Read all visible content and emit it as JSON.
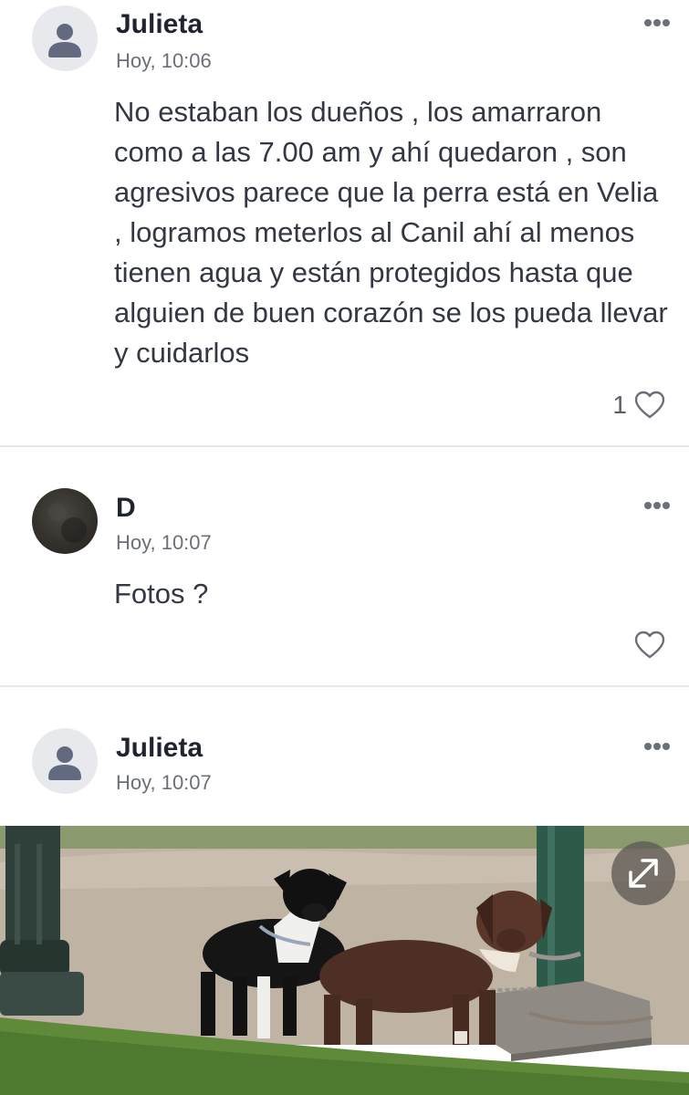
{
  "comments": [
    {
      "author": "Julieta",
      "time": "Hoy, 10:06",
      "text": "No estaban los dueños , los amarraron como a las 7.00 am y ahí quedaron , son agresivos parece que la perra está en Velia , logramos meterlos al Canil ahí al menos tienen agua y están protegidos hasta que alguien de buen corazón se los pueda llevar y cuidarlos",
      "likes": "1",
      "avatar_icon": "person-icon"
    },
    {
      "author": "D",
      "time": "Hoy, 10:07",
      "text": "Fotos ?",
      "likes": "",
      "avatar_icon": "dark-photo-avatar"
    },
    {
      "author": "Julieta",
      "time": "Hoy, 10:07",
      "text": "",
      "likes": "",
      "avatar_icon": "person-icon",
      "attachment": "photo of two leashed dogs tied to a post in a park"
    }
  ],
  "icons": {
    "more": "more-horizontal-icon",
    "like": "heart-outline-icon",
    "expand": "expand-arrows-icon"
  },
  "colors": {
    "avatar_bg": "#e8e9ed",
    "avatar_glyph": "#636a80",
    "icon_gray": "#6b6f78",
    "divider": "#e6e7ea"
  }
}
